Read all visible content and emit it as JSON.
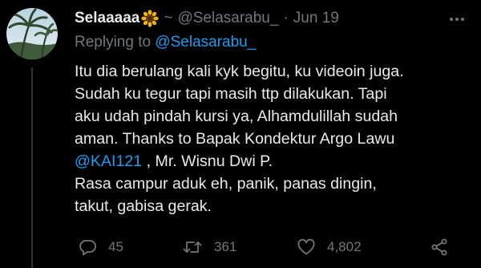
{
  "tweet": {
    "display_name": "Selaaaaa",
    "name_suffix": "~",
    "handle": "@Selasarabu_",
    "separator": "·",
    "date": "Jun 19",
    "reply_prefix": "Replying to",
    "reply_to": "@Selasarabu_",
    "body_lines": [
      "Itu dia berulang kali kyk begitu, ku videoin juga.",
      "Sudah ku tegur tapi masih ttp dilakukan. Tapi",
      "aku udah pindah kursi ya, Alhamdulillah sudah",
      "aman. Thanks to Bapak Kondektur Argo Lawu"
    ],
    "body_mention": "@KAI121",
    "body_after_mention": " , Mr. Wisnu Dwi P.",
    "body_tail_lines": [
      "Rasa campur aduk eh, panik, panas dingin,",
      "takut, gabisa gerak."
    ]
  },
  "actions": {
    "replies": "45",
    "retweets": "361",
    "likes": "4,802"
  },
  "icons": {
    "name_emoji": "sunflower-icon",
    "more": "more-dots-icon",
    "reply": "reply-icon",
    "retweet": "retweet-icon",
    "like": "heart-icon",
    "share": "share-icon"
  },
  "colors": {
    "background": "#000000",
    "text": "#e7e9ea",
    "muted": "#71767b",
    "link": "#1d9bf0"
  }
}
